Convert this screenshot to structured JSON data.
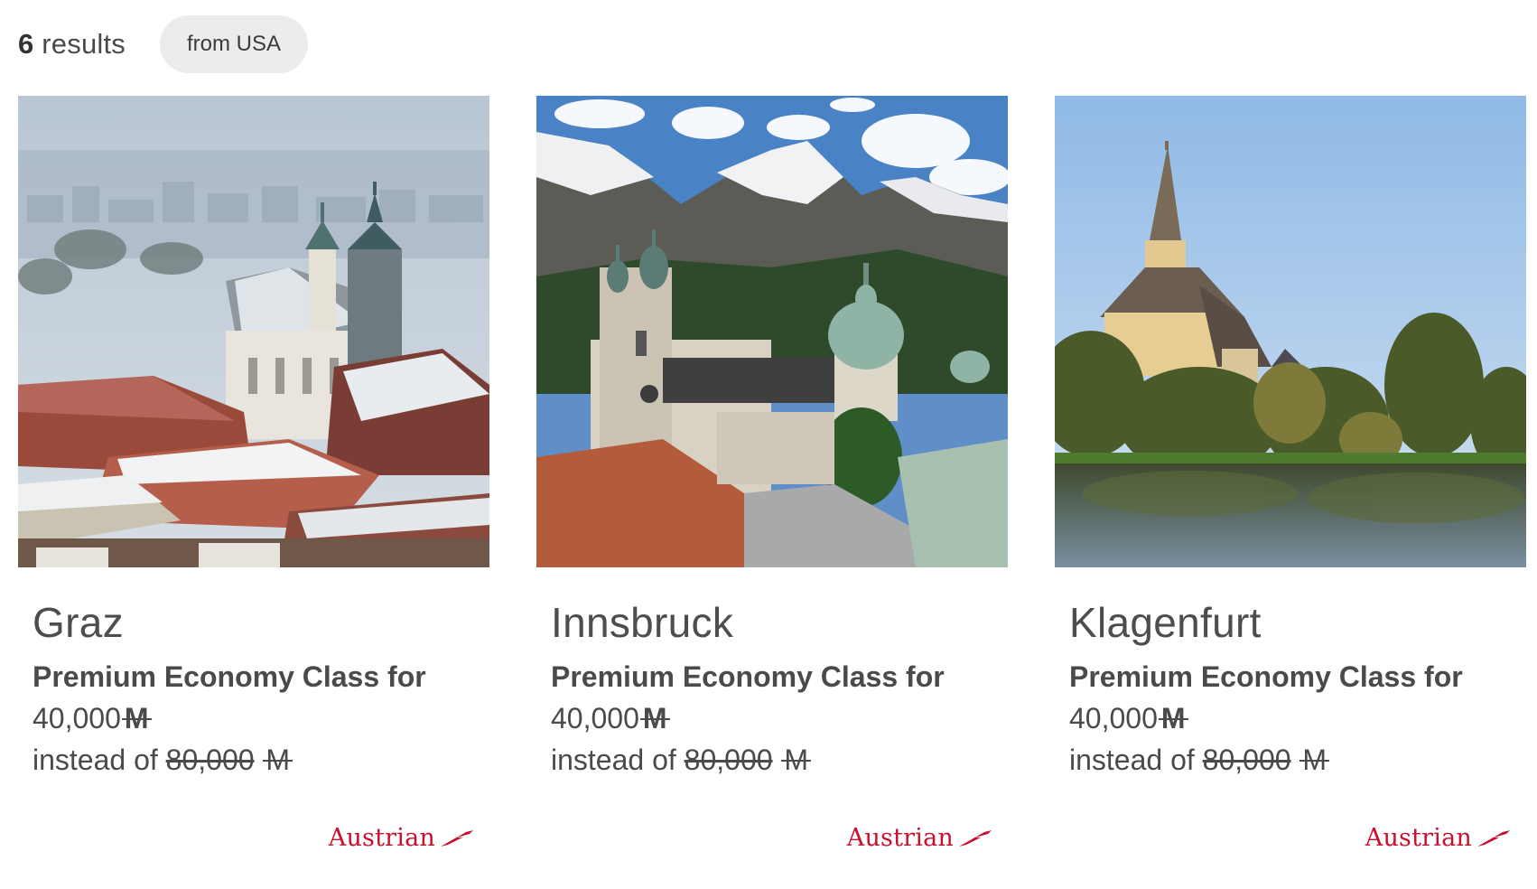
{
  "header": {
    "results_count": "6",
    "results_label": "results",
    "filter_chip": "from USA"
  },
  "cards": [
    {
      "city": "Graz",
      "offer_class": "Premium Economy Class for",
      "price": "40,000",
      "currency_symbol": "M",
      "instead_label": "instead of",
      "old_price": "80,000",
      "airline": "Austrian"
    },
    {
      "city": "Innsbruck",
      "offer_class": "Premium Economy Class for",
      "price": "40,000",
      "currency_symbol": "M",
      "instead_label": "instead of",
      "old_price": "80,000",
      "airline": "Austrian"
    },
    {
      "city": "Klagenfurt",
      "offer_class": "Premium Economy Class for",
      "price": "40,000",
      "currency_symbol": "M",
      "instead_label": "instead of",
      "old_price": "80,000",
      "airline": "Austrian"
    }
  ],
  "colors": {
    "brand_red": "#c8102e",
    "chip_bg": "#ececec",
    "text": "#4a4a4a"
  }
}
